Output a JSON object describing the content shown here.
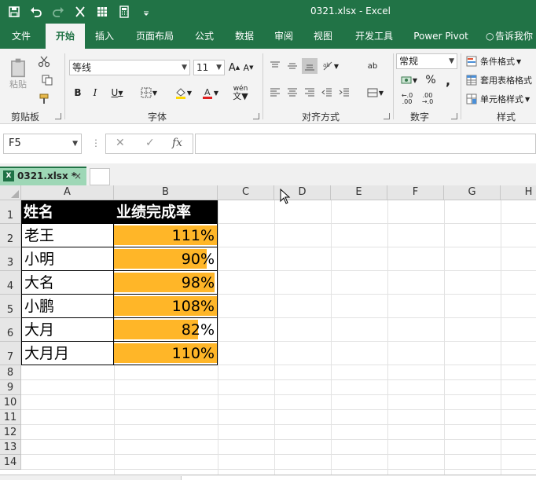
{
  "window": {
    "title": "0321.xlsx  -  Excel",
    "accent": "#217346"
  },
  "quick_access": {
    "icons": [
      "save-icon",
      "undo-icon",
      "redo-icon",
      "cut-icon",
      "grid-icon",
      "calculator-icon",
      "customize-icon"
    ]
  },
  "ribbon_tabs": [
    "文件",
    "开始",
    "插入",
    "页面布局",
    "公式",
    "数据",
    "审阅",
    "视图",
    "开发工具",
    "Power Pivot",
    "告诉我你"
  ],
  "ribbon": {
    "clipboard": {
      "label": "剪贴板",
      "paste_label": "粘贴"
    },
    "font": {
      "label": "字体",
      "font_name": "等线",
      "font_size": "11",
      "wen_label": "wén"
    },
    "alignment": {
      "label": "对齐方式",
      "ab_label": "ab"
    },
    "number": {
      "label": "数字",
      "format": "常规",
      "percent": "%",
      "comma": ","
    },
    "styles": {
      "label": "样式",
      "conditional": "条件格式",
      "table": "套用表格格式",
      "cell": "单元格样式"
    }
  },
  "formula_bar": {
    "name_box": "F5",
    "fx": "fx",
    "cancel": "✕",
    "enter": "✓",
    "content": ""
  },
  "workbook_tab": {
    "name": "0321.xlsx *",
    "close": "×",
    "icon_text": "X"
  },
  "columns": [
    "A",
    "B",
    "C",
    "D",
    "E",
    "F",
    "G",
    "H"
  ],
  "rows": [
    "1",
    "2",
    "3",
    "4",
    "5",
    "6",
    "7",
    "8",
    "9",
    "10",
    "11",
    "12",
    "13",
    "14"
  ],
  "sheet": {
    "header": {
      "name": "姓名",
      "rate": "业绩完成率"
    },
    "bar_color": "#ffb628",
    "records": [
      {
        "name": "老王",
        "rate": "111%",
        "fill": 1.0
      },
      {
        "name": "小明",
        "rate": "90%",
        "fill": 0.9
      },
      {
        "name": "大名",
        "rate": "98%",
        "fill": 0.98
      },
      {
        "name": "小鹏",
        "rate": "108%",
        "fill": 1.0
      },
      {
        "name": "大月",
        "rate": "82%",
        "fill": 0.82
      },
      {
        "name": "大月月",
        "rate": "110%",
        "fill": 1.0
      }
    ]
  }
}
